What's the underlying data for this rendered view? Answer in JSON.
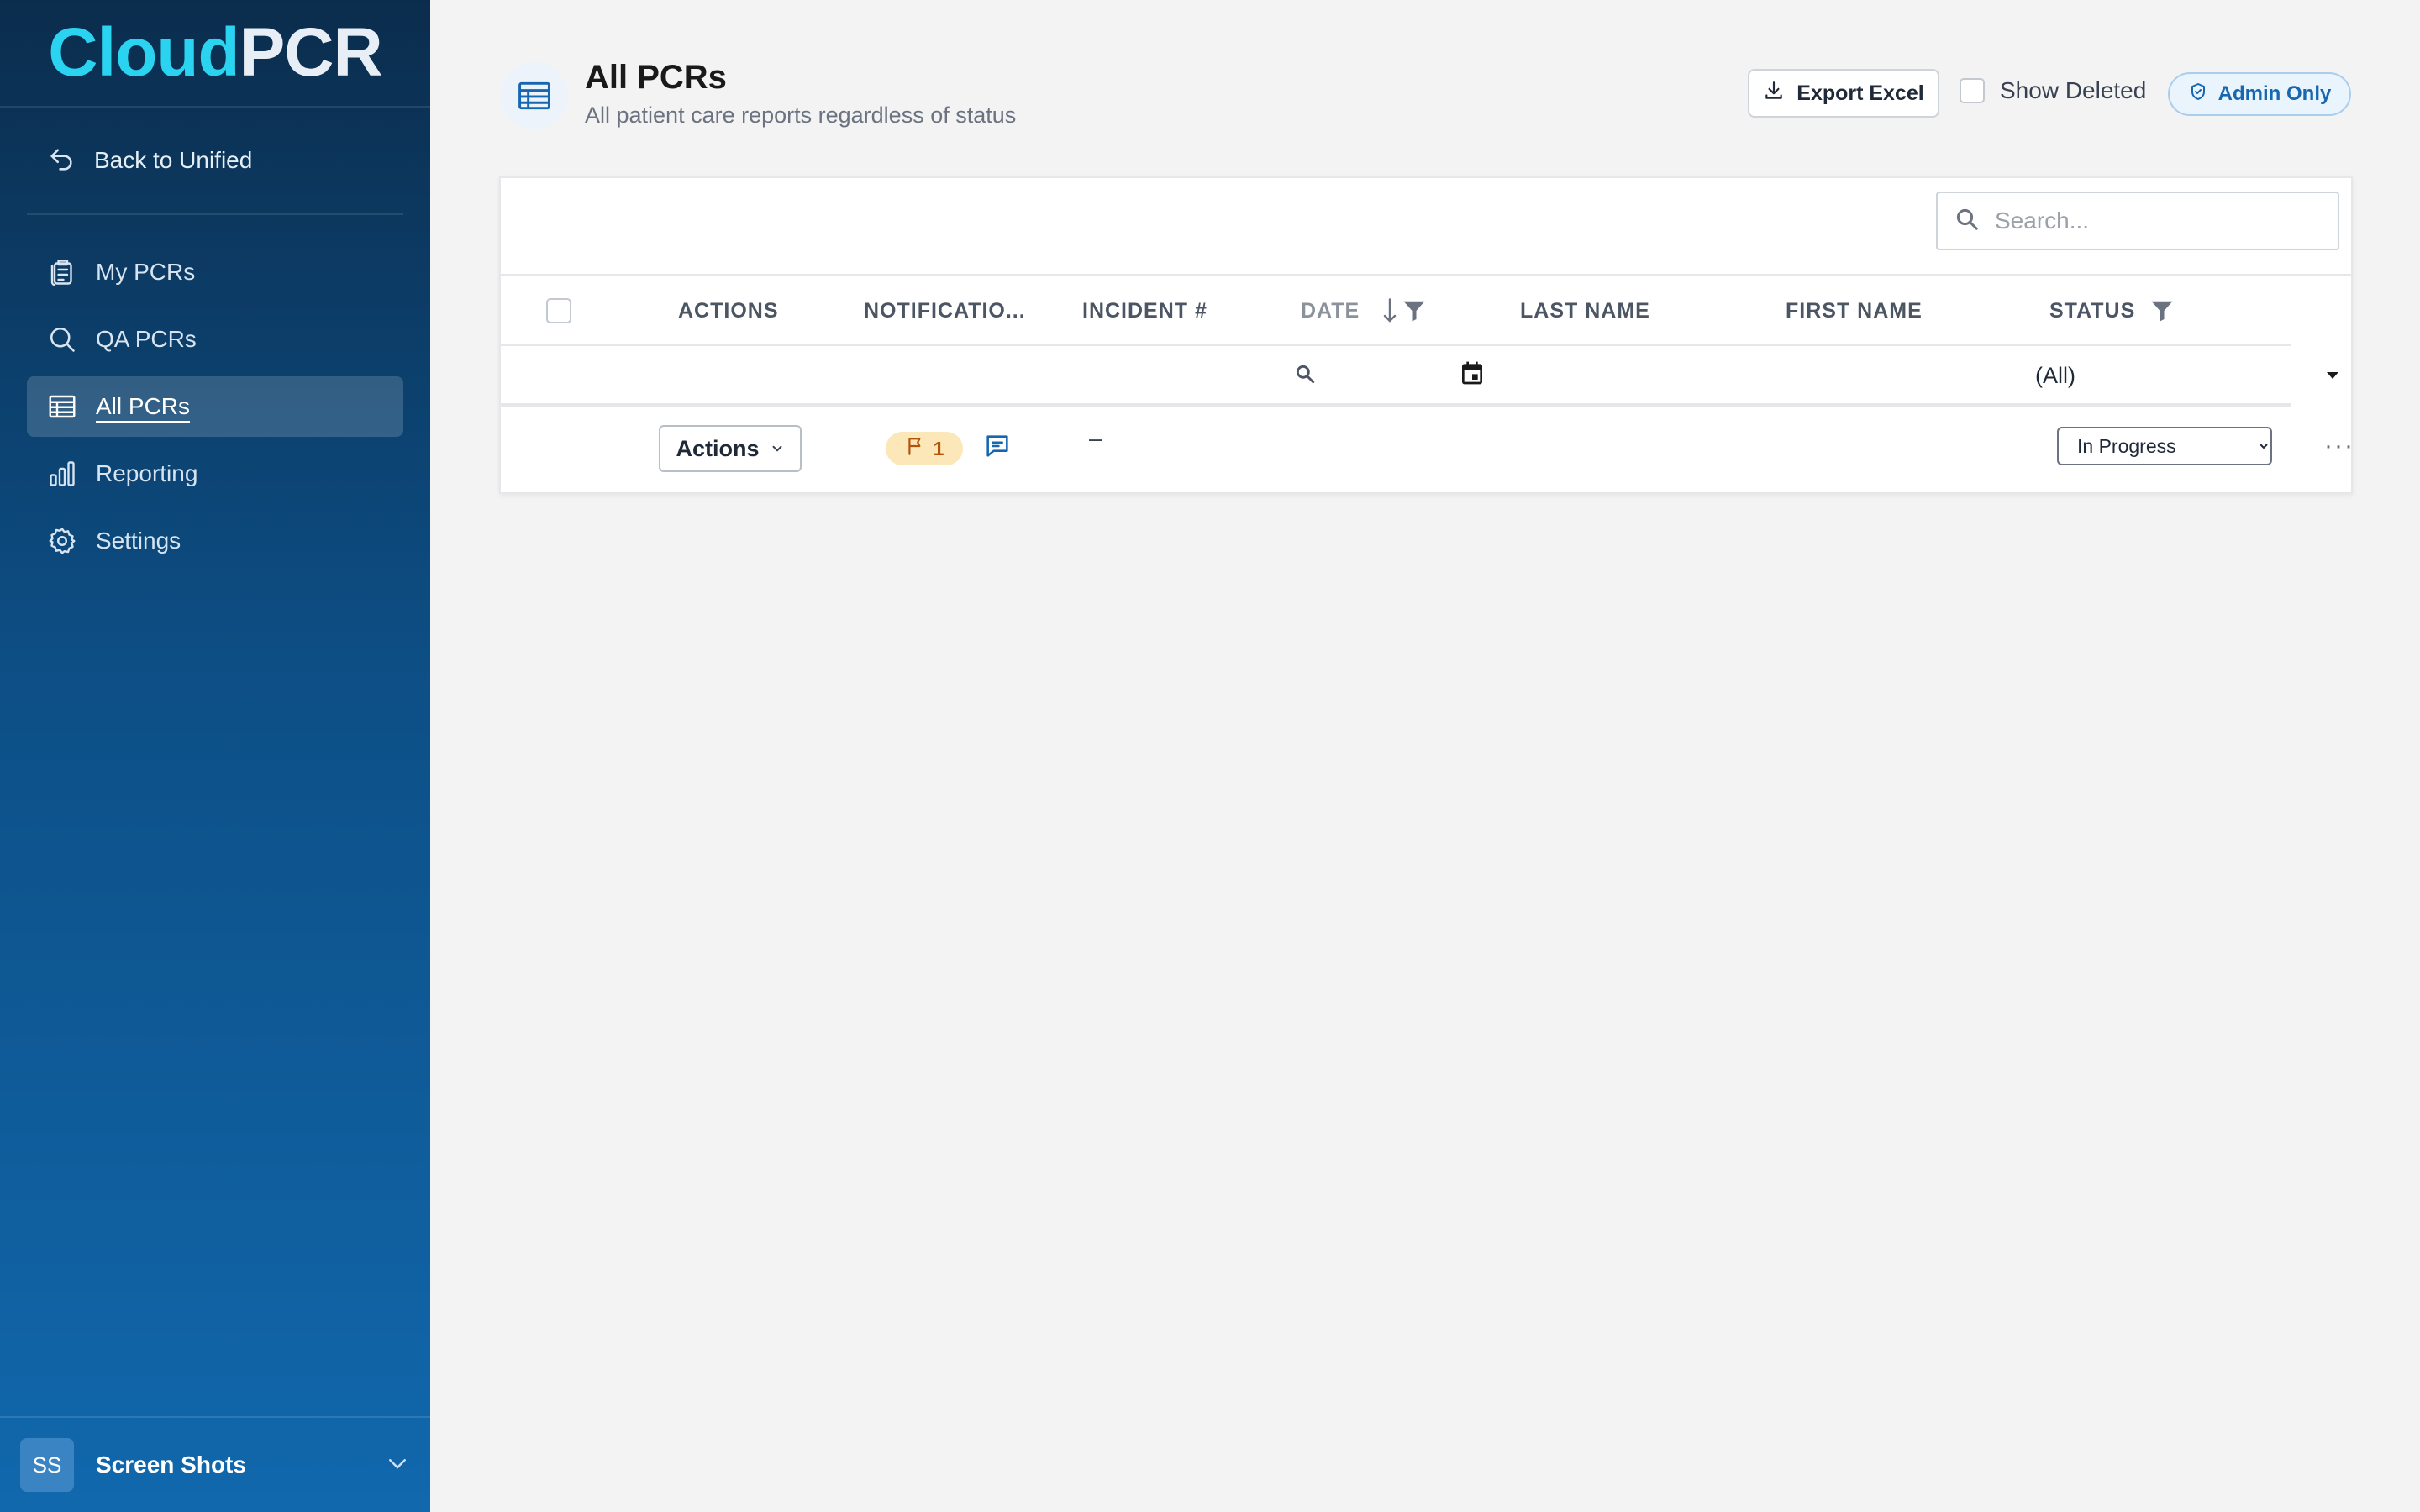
{
  "app": {
    "logo_part1": "Cloud",
    "logo_part2": "PCR"
  },
  "sidebar": {
    "back_label": "Back to Unified",
    "items": [
      {
        "label": "My PCRs",
        "icon": "clipboard-list-icon"
      },
      {
        "label": "QA PCRs",
        "icon": "search-icon"
      },
      {
        "label": "All PCRs",
        "icon": "table-icon",
        "active": true
      },
      {
        "label": "Reporting",
        "icon": "bar-chart-icon"
      },
      {
        "label": "Settings",
        "icon": "gear-icon"
      }
    ],
    "user": {
      "initials": "SS",
      "name": "Screen Shots"
    }
  },
  "header": {
    "title": "All PCRs",
    "subtitle": "All patient care reports regardless of status",
    "export_label": "Export Excel",
    "show_deleted_label": "Show Deleted",
    "admin_badge_label": "Admin Only"
  },
  "grid": {
    "search_placeholder": "Search...",
    "columns": [
      "ACTIONS",
      "NOTIFICATIO...",
      "INCIDENT #",
      "DATE",
      "LAST NAME",
      "FIRST NAME",
      "STATUS"
    ],
    "status_filter_value": "(All)",
    "rows": [
      {
        "actions_label": "Actions",
        "flag_count": "1",
        "incident": "–",
        "status": "In Progress"
      }
    ]
  },
  "colors": {
    "sidebar_top": "#0b2d4d",
    "sidebar_bottom": "#1168ad",
    "accent": "#1667b0",
    "flag_bg": "#fbe7b8"
  }
}
